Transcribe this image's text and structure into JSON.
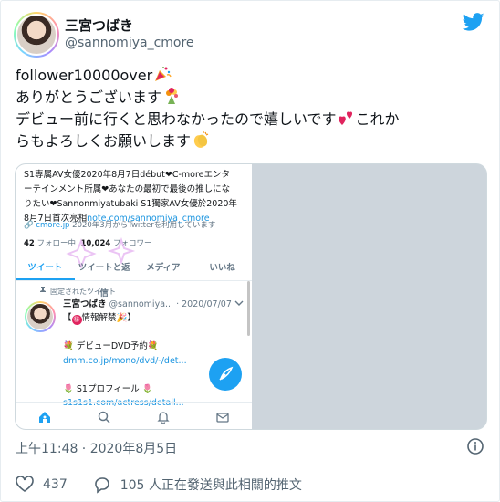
{
  "author": {
    "display_name": "三宮つばき",
    "handle": "@sannomiya_cmore"
  },
  "tweet": {
    "line1": "follower10000over",
    "line2": "ありがとうございます",
    "line3": "デビュー前に行くと思わなかったので嬉しいです",
    "line3_tail": "これか",
    "line4": "らもよろしくお願いします",
    "emoji_1": "party-popper-icon",
    "emoji_2": "bouquet-icon",
    "emoji_3": "two-hearts-icon",
    "emoji_4": "clapping-hands-icon"
  },
  "media": {
    "bio_line1": "S1専属AV女優2020年8月7日début❤C-moreエンタ",
    "bio_line2": "ーテインメント所属❤あなたの最初で最後の推しにな",
    "bio_line3": "りたい❤Sannonmiyatubaki S1獨家AV女優於2020年",
    "bio_line4_prefix": "8月7日首次亮相",
    "bio_link": "note.com/sannomiya_cmore",
    "meta_link": "cmore.jp",
    "meta_rest": "2020年3月からTwitterを利用しています",
    "following_count": "42",
    "following_label": "フォロー中",
    "followers_count": "10,024",
    "followers_label": "フォロワー",
    "tabs": [
      "ツイート",
      "ツイートと返信",
      "メディア",
      "いいね"
    ],
    "pinned_label": "固定されたツイート",
    "pinned_name": "三宮つばき",
    "pinned_handle_date": "@sannomiya... · 2020/07/07",
    "pinned_line1": "【",
    "pinned_line1_badge": "㊙",
    "pinned_line1_rest": "情報解禁",
    "pinned_line1_end": "】",
    "pinned_line2": "デビューDVD予約",
    "pinned_link1": "dmm.co.jp/mono/dvd/-/det...",
    "pinned_line3": "S1プロフィール",
    "pinned_link2": "s1s1s1.com/actress/detail..."
  },
  "timestamp": "上午11:48 · 2020年8月5日",
  "likes": "437",
  "replies_text": "105 人正在發送與此相關的推文",
  "colors": {
    "accent": "#1da1f2",
    "text": "#0f1419",
    "muted": "#536471",
    "heart_pink": "#e0245e"
  }
}
